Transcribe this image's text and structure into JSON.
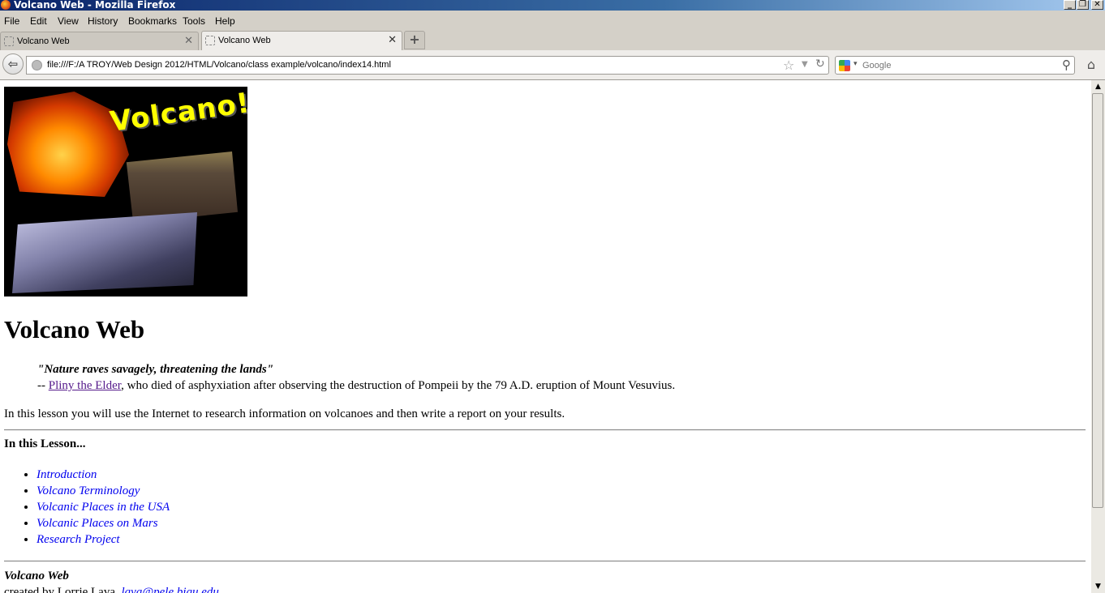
{
  "window": {
    "title": "Volcano Web - Mozilla Firefox"
  },
  "menu": [
    "File",
    "Edit",
    "View",
    "History",
    "Bookmarks",
    "Tools",
    "Help"
  ],
  "tabs": [
    {
      "label": "Volcano Web",
      "active": false
    },
    {
      "label": "Volcano Web",
      "active": true
    }
  ],
  "navbar": {
    "url": "file:///F:/A TROY/Web Design 2012/HTML/Volcano/class example/volcano/index14.html",
    "search_placeholder": "Google"
  },
  "icons": {
    "back": "back-arrow-icon",
    "site": "site-identity-icon",
    "bookmark": "star-icon",
    "history_drop": "dropdown-icon",
    "reload": "reload-icon",
    "search_engine": "google-icon",
    "search": "magnifier-icon",
    "home": "home-icon",
    "new_tab": "plus-icon",
    "close_tab": "close-icon"
  },
  "page": {
    "banner_text": "Volcano!",
    "title": "Volcano Web",
    "quote": "\"Nature raves savagely, threatening the lands\"",
    "quote_prefix": "-- ",
    "quote_author": "Pliny the Elder",
    "quote_suffix": ", who died of asphyxiation after observing the destruction of Pompeii by the 79 A.D. eruption of Mount Vesuvius.",
    "intro": "In this lesson you will use the Internet to research information on volcanoes and then write a report on your results.",
    "lesson_heading": "In this Lesson...",
    "lessons": [
      "Introduction",
      "Volcano Terminology",
      "Volcanic Places in the USA",
      "Volcanic Places on Mars",
      "Research Project"
    ],
    "footer_title": "Volcano Web",
    "footer_credit_prefix": "created by Lorrie Lava, ",
    "footer_email": "lava@pele.bigu.edu"
  },
  "colors": {
    "visited_link": "#551a8b",
    "link": "#0000ee",
    "banner_text": "#ffff00"
  }
}
